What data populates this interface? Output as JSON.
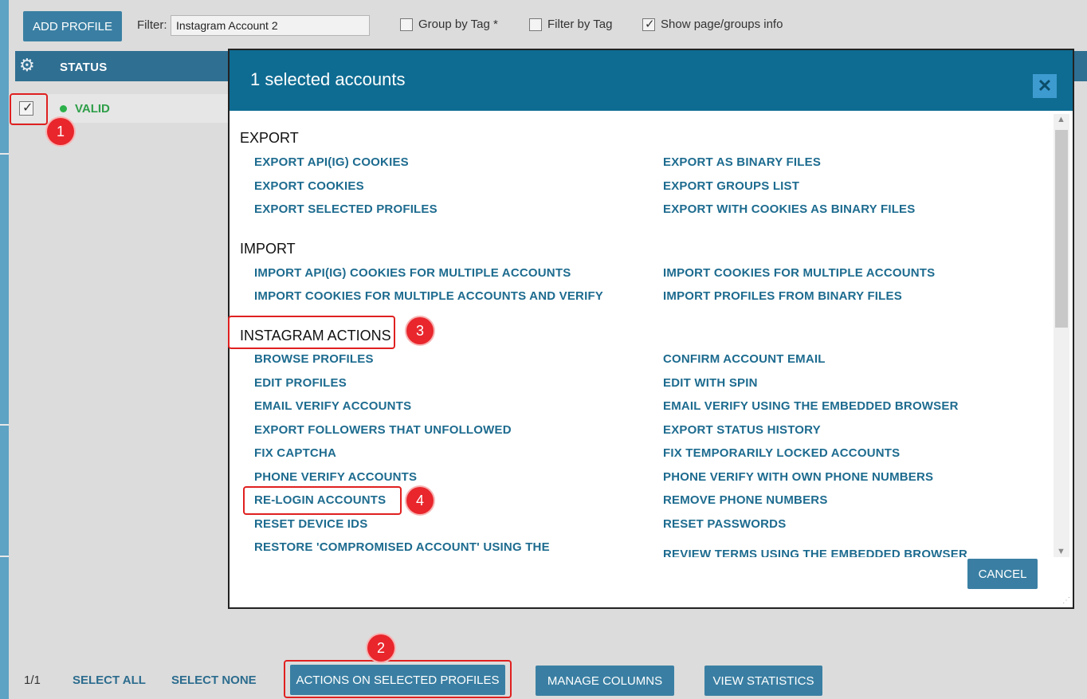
{
  "toolbar": {
    "add_profile": "ADD PROFILE",
    "filter_label": "Filter:",
    "filter_value": "Instagram Account 2",
    "group_by_tag": "Group by Tag *",
    "filter_by_tag": "Filter by Tag",
    "show_info": "Show page/groups info"
  },
  "table": {
    "status_header": "STATUS",
    "row_status": "VALID"
  },
  "badges": {
    "b1": "1",
    "b2": "2",
    "b3": "3",
    "b4": "4"
  },
  "modal": {
    "title": "1 selected accounts",
    "close": "✕",
    "cancel": "CANCEL",
    "export": {
      "title": "EXPORT",
      "left": [
        "EXPORT API(IG) COOKIES",
        "EXPORT COOKIES",
        "EXPORT SELECTED PROFILES"
      ],
      "right": [
        "EXPORT AS BINARY FILES",
        "EXPORT GROUPS LIST",
        "EXPORT WITH COOKIES AS BINARY FILES"
      ]
    },
    "import": {
      "title": "IMPORT",
      "left": [
        "IMPORT API(IG) COOKIES FOR MULTIPLE ACCOUNTS",
        "IMPORT COOKIES FOR MULTIPLE ACCOUNTS AND VERIFY"
      ],
      "right": [
        "IMPORT COOKIES FOR MULTIPLE ACCOUNTS",
        "IMPORT PROFILES FROM BINARY FILES"
      ]
    },
    "instagram": {
      "title": "INSTAGRAM ACTIONS",
      "left": [
        "BROWSE PROFILES",
        "EDIT PROFILES",
        "EMAIL VERIFY ACCOUNTS",
        "EXPORT FOLLOWERS THAT UNFOLLOWED",
        "FIX CAPTCHA",
        "PHONE VERIFY ACCOUNTS",
        "RE-LOGIN ACCOUNTS",
        "RESET DEVICE IDS",
        "RESTORE 'COMPROMISED ACCOUNT' USING THE"
      ],
      "right": [
        "CONFIRM ACCOUNT EMAIL",
        "EDIT WITH SPIN",
        "EMAIL VERIFY USING THE EMBEDDED BROWSER",
        "EXPORT STATUS HISTORY",
        "FIX TEMPORARILY LOCKED ACCOUNTS",
        "PHONE VERIFY WITH OWN PHONE NUMBERS",
        "REMOVE PHONE NUMBERS",
        "RESET PASSWORDS",
        "REVIEW TERMS USING THE EMBEDDED BROWSER"
      ]
    }
  },
  "footer": {
    "count": "1/1",
    "select_all": "SELECT ALL",
    "select_none": "SELECT NONE",
    "actions": "ACTIONS ON SELECTED PROFILES",
    "manage_columns": "MANAGE COLUMNS",
    "view_statistics": "VIEW STATISTICS"
  },
  "colors": {
    "primary": "#3a7fa3",
    "modal_header": "#0e6c92",
    "link": "#1d6b8f",
    "valid": "#2e9e48",
    "highlight": "#e02020"
  }
}
